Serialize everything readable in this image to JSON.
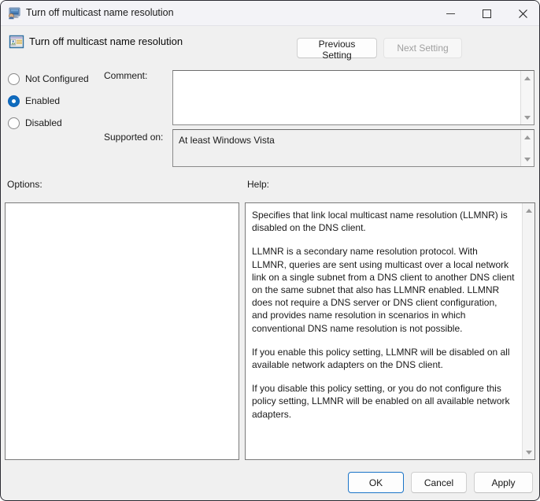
{
  "window": {
    "title": "Turn off multicast name resolution",
    "icon": "monitor-policy-icon",
    "caption": {
      "minimize": "minimize-icon",
      "maximize": "maximize-icon",
      "close": "close-icon"
    }
  },
  "header": {
    "icon": "policy-setting-icon",
    "policy_name": "Turn off multicast name resolution",
    "previous_setting_label": "Previous Setting",
    "next_setting_label": "Next Setting",
    "next_setting_disabled": true
  },
  "state": {
    "options": [
      {
        "label": "Not Configured",
        "selected": false
      },
      {
        "label": "Enabled",
        "selected": true
      },
      {
        "label": "Disabled",
        "selected": false
      }
    ]
  },
  "fields": {
    "comment_label": "Comment:",
    "comment_value": "",
    "supported_label": "Supported on:",
    "supported_value": "At least Windows Vista"
  },
  "panels": {
    "options_label": "Options:",
    "help_label": "Help:",
    "options_content": "",
    "help_paragraphs": [
      "Specifies that link local multicast name resolution (LLMNR) is disabled on the DNS client.",
      "LLMNR is a secondary name resolution protocol. With LLMNR, queries are sent using multicast over a local network link on a single subnet from a DNS client to another DNS client on the same subnet that also has LLMNR enabled. LLMNR does not require a DNS server or DNS client configuration, and provides name resolution in scenarios in which conventional DNS name resolution is not possible.",
      "If you enable this policy setting, LLMNR will be disabled on all available network adapters on the DNS client.",
      "If you disable this policy setting, or you do not configure this policy setting, LLMNR will be enabled on all available network adapters."
    ]
  },
  "footer": {
    "ok_label": "OK",
    "cancel_label": "Cancel",
    "apply_label": "Apply"
  },
  "colors": {
    "accent": "#0f6cbd",
    "default_button_border": "#1a74c8",
    "titlebar_bg": "#f3f3f7",
    "dialog_bg": "#f0f0f0"
  }
}
